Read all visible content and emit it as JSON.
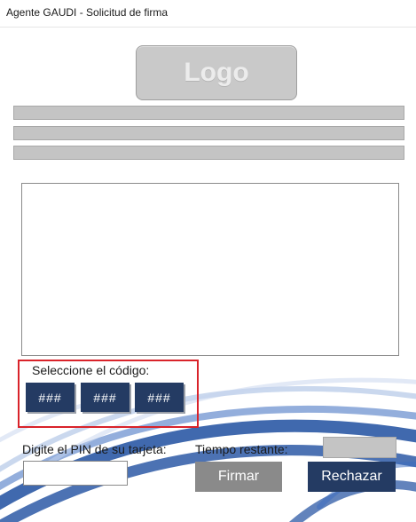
{
  "window": {
    "title": "Agente GAUDI - Solicitud de firma"
  },
  "header": {
    "logo_text": "Logo"
  },
  "code_selection": {
    "label": "Seleccione el código:",
    "options": [
      "###",
      "###",
      "###"
    ]
  },
  "pin": {
    "label": "Digite el PIN de su tarjeta:",
    "value": ""
  },
  "timer": {
    "label": "Tiempo restante:",
    "value": ""
  },
  "actions": {
    "sign_label": "Firmar",
    "reject_label": "Rechazar"
  },
  "colors": {
    "primary_button": "#243b63",
    "disabled_button": "#8a8a8a",
    "highlight_border": "#d9232a",
    "placeholder_gray": "#c4c4c4"
  }
}
